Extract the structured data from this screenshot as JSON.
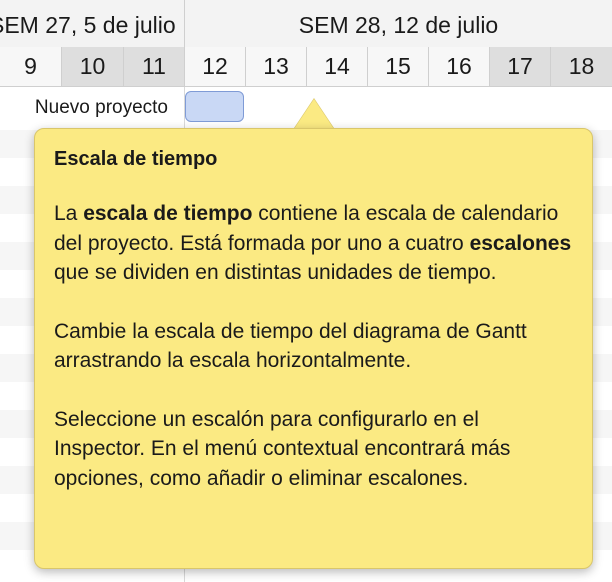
{
  "timescale": {
    "weeks": [
      {
        "label": "SEM 27, 5 de julio"
      },
      {
        "label": "SEM 28, 12 de julio"
      }
    ],
    "days": [
      {
        "label": "9",
        "weekend": false
      },
      {
        "label": "10",
        "weekend": true
      },
      {
        "label": "11",
        "weekend": true
      },
      {
        "label": "12",
        "weekend": false
      },
      {
        "label": "13",
        "weekend": false
      },
      {
        "label": "14",
        "weekend": false
      },
      {
        "label": "15",
        "weekend": false
      },
      {
        "label": "16",
        "weekend": false
      },
      {
        "label": "17",
        "weekend": true
      },
      {
        "label": "18",
        "weekend": true
      }
    ]
  },
  "project": {
    "name": "Nuevo proyecto"
  },
  "popover": {
    "title": "Escala de tiempo",
    "p1": {
      "t1": "La ",
      "b1": "escala de tiempo",
      "t2": " contiene la escala de calendario del proyecto. Está formada por uno a cuatro ",
      "b2": "escalones",
      "t3": " que se dividen en distintas unidades de tiempo."
    },
    "p2": "Cambie la escala de tiempo del diagrama de Gantt arrastrando la escala horizontalmente.",
    "p3": "Seleccione un escalón para configurarlo en el Inspector. En el menú contextual encontrará más opciones, como añadir o eliminar escalones."
  },
  "colors": {
    "popover_bg": "#fbea83",
    "task_bar": "#c9d8f5",
    "weekend": "#dedede"
  }
}
